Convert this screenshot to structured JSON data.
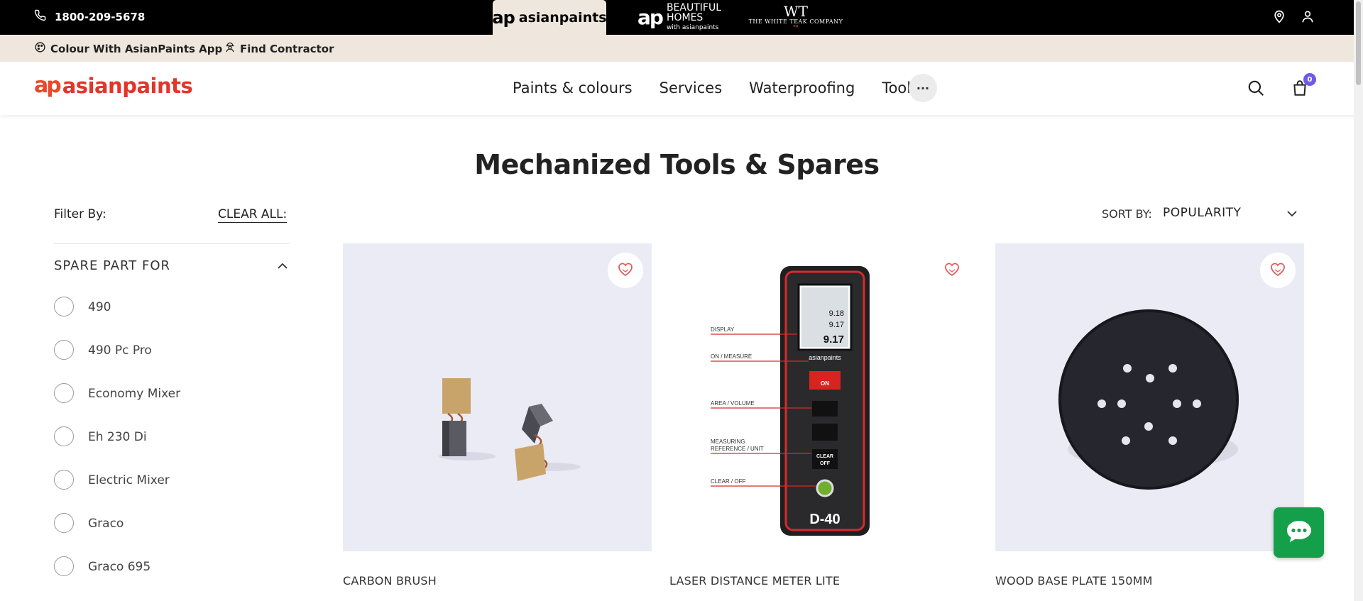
{
  "topbar": {
    "phone": "1800-209-5678",
    "brands": [
      {
        "mark": "ap",
        "label": "asianpaints"
      },
      {
        "mark": "ap",
        "label_line1": "BEAUTIFUL",
        "label_line2": "HOMES",
        "label_line3": "with asianpaints"
      },
      {
        "mark": "WT",
        "label": "THE WHITE TEAK COMPANY"
      }
    ]
  },
  "subbar": {
    "app_link": "Colour With AsianPaints App",
    "contractor_link": "Find Contractor"
  },
  "nav": {
    "logo_mark": "ap",
    "logo_text": "asianpaints",
    "items": [
      "Paints & colours",
      "Services",
      "Waterproofing",
      "Tools"
    ],
    "more_label": "···",
    "cart_count": "0"
  },
  "page": {
    "title": "Mechanized Tools & Spares"
  },
  "filter": {
    "label": "Filter By:",
    "clear_label": "CLEAR ALL:",
    "section_title": "SPARE PART FOR",
    "options": [
      "490",
      "490 Pc Pro",
      "Economy Mixer",
      "Eh 230 Di",
      "Electric Mixer",
      "Graco",
      "Graco 695"
    ]
  },
  "sort": {
    "label": "SORT BY:",
    "value": "POPULARITY"
  },
  "products": [
    {
      "name": "CARBON BRUSH"
    },
    {
      "name": "LASER DISTANCE METER LITE",
      "callouts": [
        "DISPLAY",
        "ON / MEASURE",
        "AREA / VOLUME",
        "MEASURING",
        "REFERENCE / UNIT",
        "CLEAR / OFF"
      ],
      "device_brand": "asianpaints",
      "device_model": "D-40",
      "button_labels": [
        "ON",
        "CLEAR",
        "OFF"
      ],
      "display_readings": [
        "9.18",
        "9.17",
        "9.17"
      ]
    },
    {
      "name": "WOOD BASE PLATE 150MM"
    }
  ],
  "colors": {
    "brand_red": "#e2362a",
    "accent_green": "#14a04b",
    "badge_purple": "#6c5ce7",
    "beige": "#efe7dd"
  }
}
